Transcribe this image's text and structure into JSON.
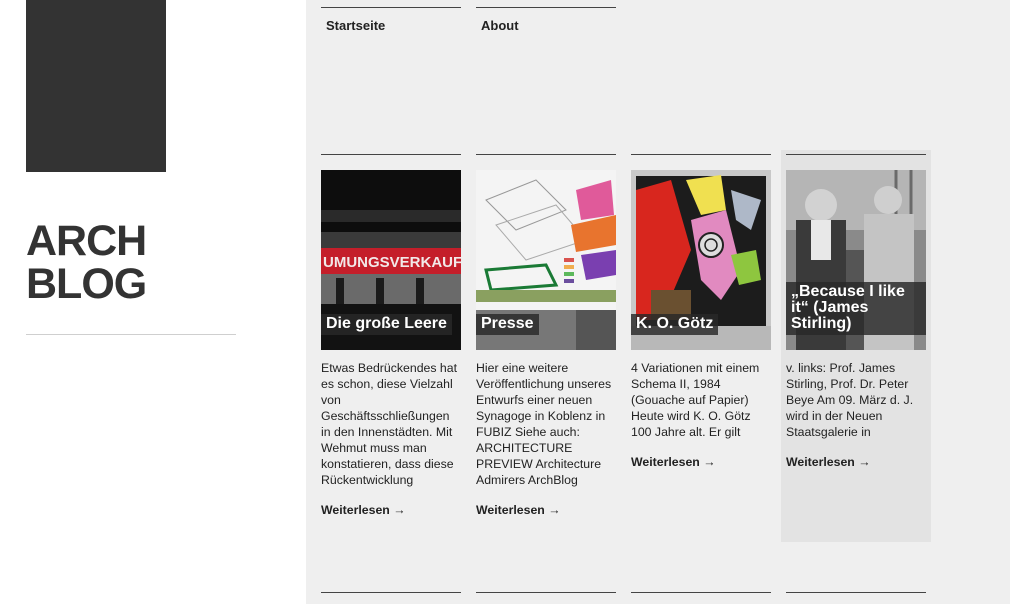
{
  "site": {
    "title_line1": "ARCH",
    "title_line2": "BLOG"
  },
  "nav": [
    {
      "label": "Startseite"
    },
    {
      "label": "About"
    }
  ],
  "posts": [
    {
      "title": "Die große Leere",
      "excerpt": "Etwas Bedrückendes hat es schon, diese Vielzahl von Geschäftsschließungen in den Innenstädten. Mit Wehmut muss man konstatieren, dass diese Rückentwicklung",
      "more": "Weiterlesen →",
      "image_text": "UMUNGSVERKAUF"
    },
    {
      "title": "Presse",
      "excerpt": "Hier eine weitere Veröffentlichung unseres Entwurfs einer neuen Synagoge in Koblenz in FUBIZ Siehe auch: ARCHITECTURE PREVIEW Architecture Admirers ArchBlog",
      "more": "Weiterlesen →"
    },
    {
      "title": "K. O. Götz",
      "excerpt": "4 Variationen mit einem Schema II, 1984 (Gouache auf Papier) Heute wird K. O. Götz 100 Jahre alt. Er gilt",
      "more": "Weiterlesen →"
    },
    {
      "title": "„Because I like it“ (James Stirling)",
      "excerpt": "v. links: Prof. James Stirling, Prof. Dr. Peter Beye Am 09. März d. J. wird in der Neuen Staatsgalerie in",
      "more": "Weiterlesen →"
    }
  ],
  "colors": {
    "sidebar_box": "#333333",
    "main_bg": "#efefef",
    "highlight_bg": "#e3e3e3"
  }
}
